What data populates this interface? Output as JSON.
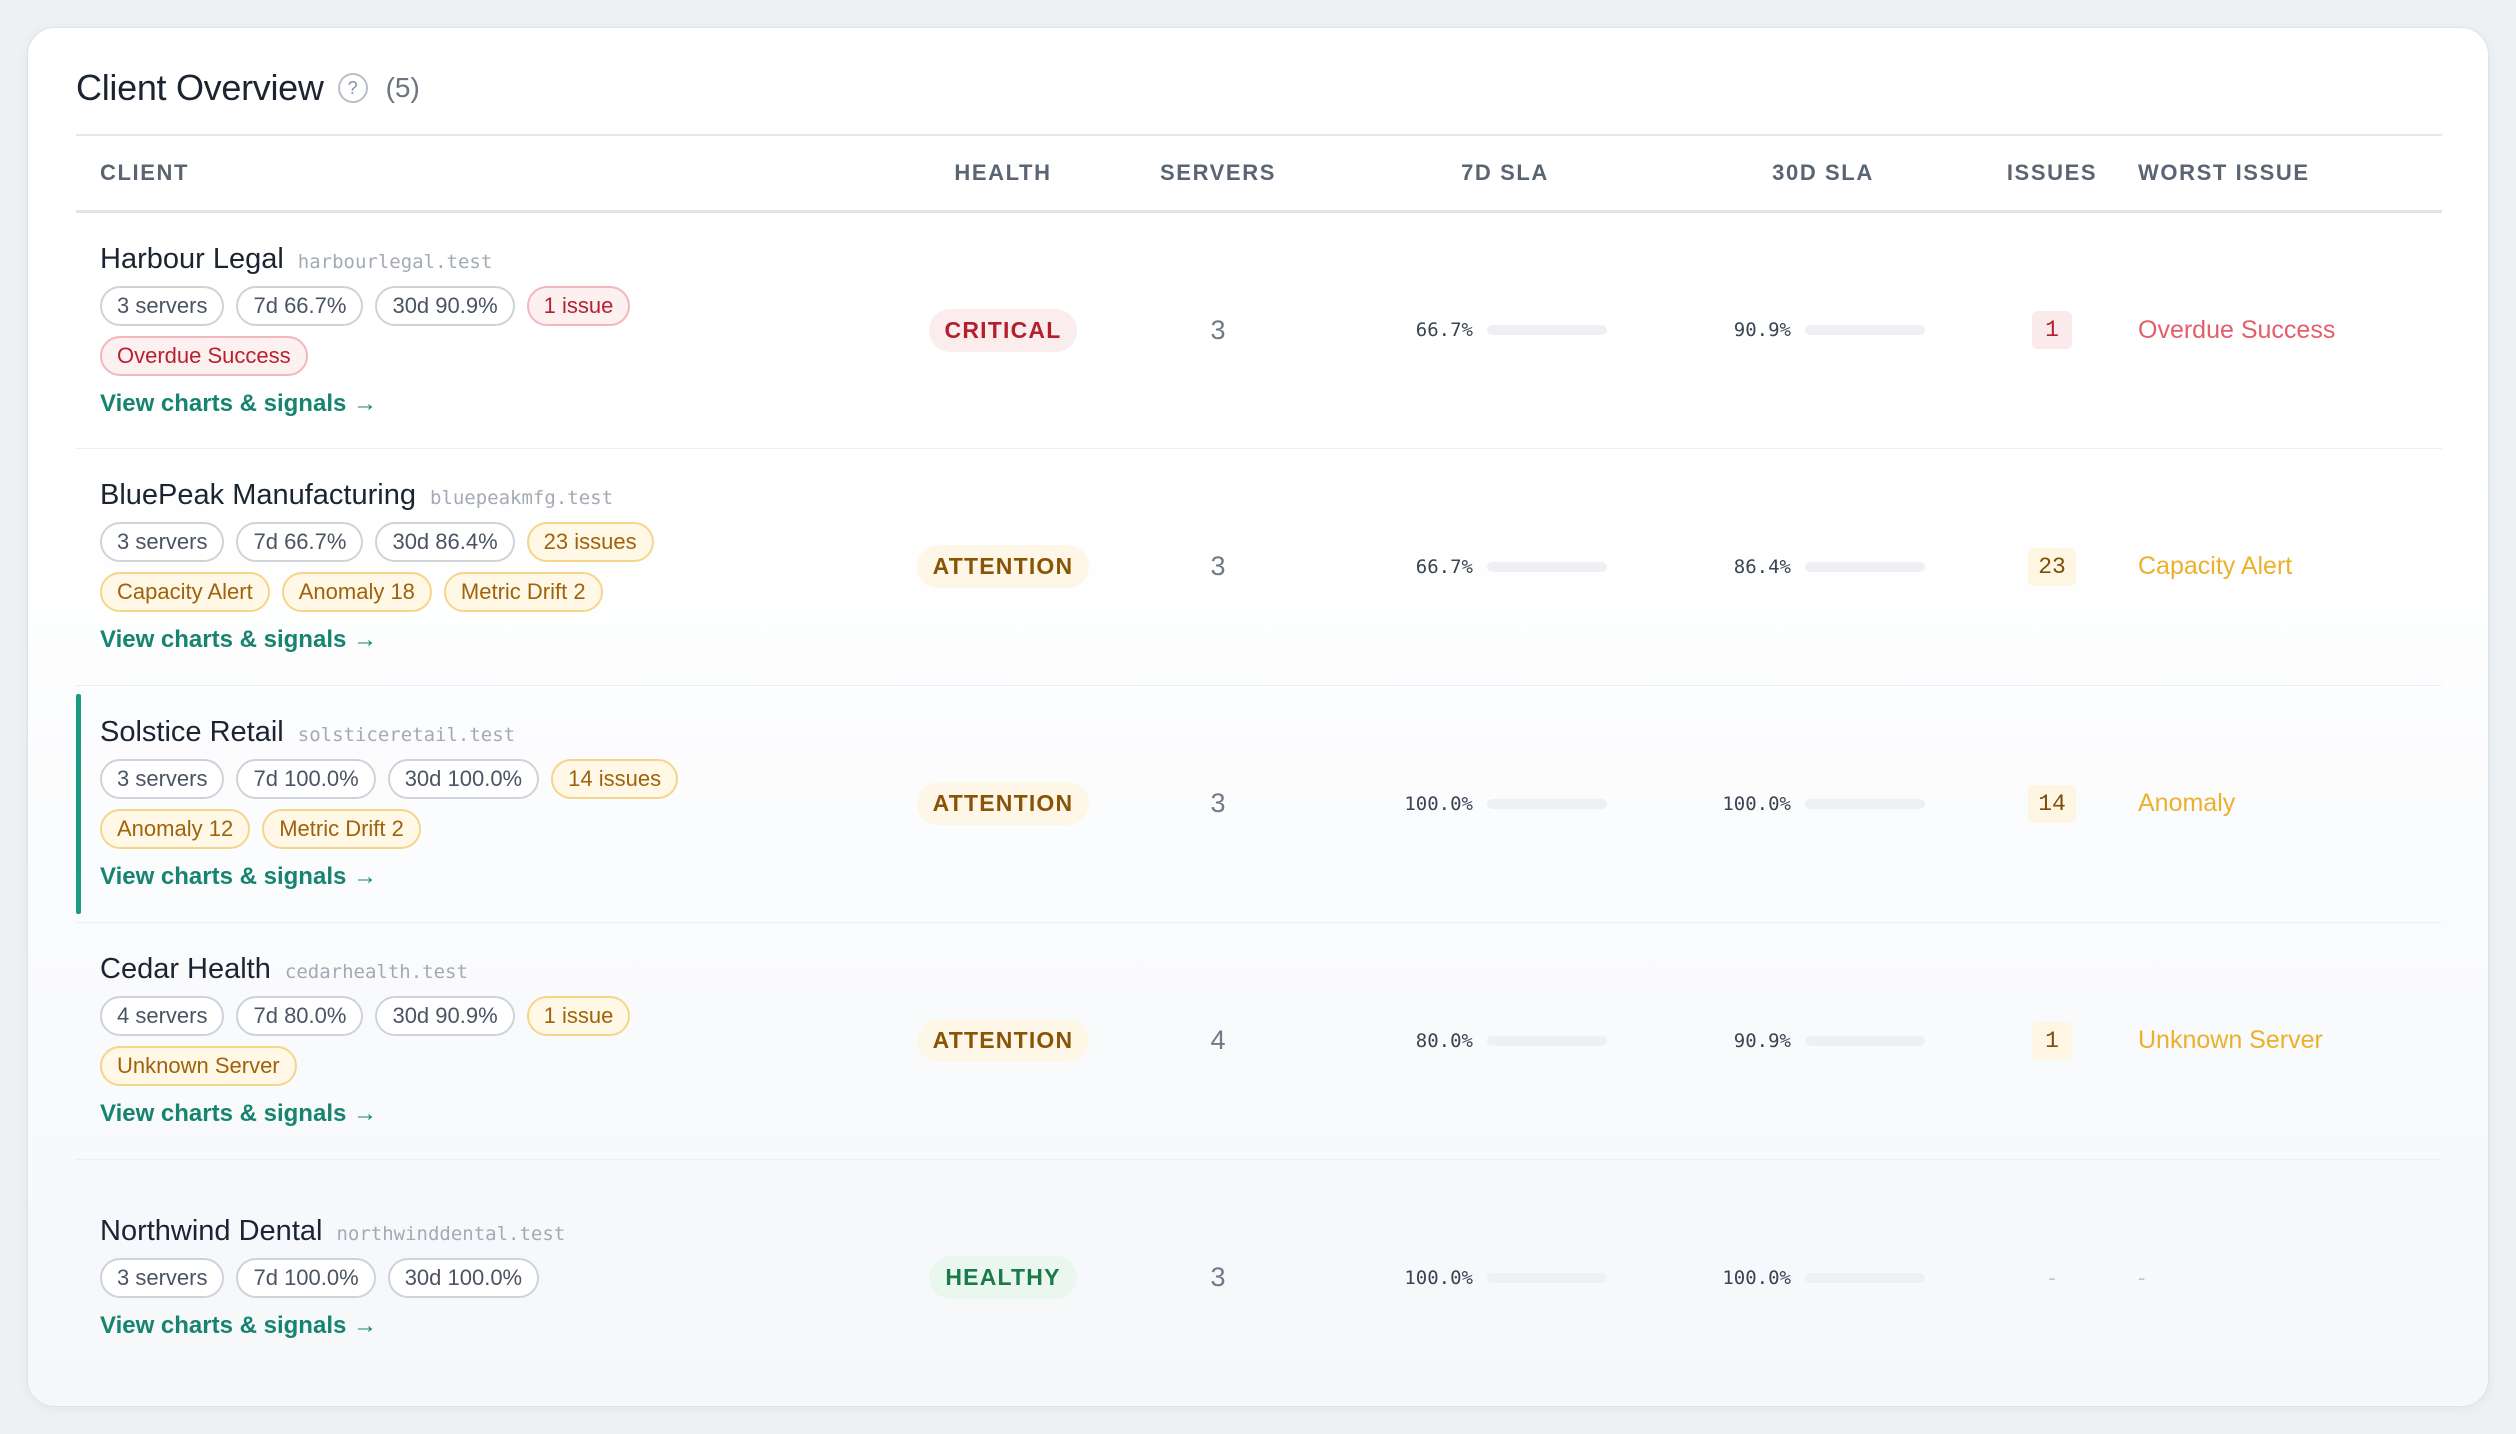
{
  "header": {
    "title": "Client Overview",
    "help": "?",
    "count": "(5)"
  },
  "columns": {
    "client": "CLIENT",
    "health": "HEALTH",
    "servers": "SERVERS",
    "sla7": "7D SLA",
    "sla30": "30D SLA",
    "issues": "ISSUES",
    "worst": "WORST ISSUE"
  },
  "link_label": "View charts & signals →",
  "rows": [
    {
      "name": "Harbour Legal",
      "domain": "harbourlegal.test",
      "chips": [
        "3 servers",
        "7d 66.7%",
        "30d 90.9%"
      ],
      "issue_chip": "1 issue",
      "tags": [
        "Overdue Success"
      ],
      "health": "CRITICAL",
      "servers": "3",
      "sla7": "66.7%",
      "sla30": "90.9%",
      "issues": "1",
      "worst": "Overdue Success"
    },
    {
      "name": "BluePeak Manufacturing",
      "domain": "bluepeakmfg.test",
      "chips": [
        "3 servers",
        "7d 66.7%",
        "30d 86.4%"
      ],
      "issue_chip": "23 issues",
      "tags": [
        "Capacity Alert",
        "Anomaly 18",
        "Metric Drift 2"
      ],
      "health": "ATTENTION",
      "servers": "3",
      "sla7": "66.7%",
      "sla30": "86.4%",
      "issues": "23",
      "worst": "Capacity Alert"
    },
    {
      "name": "Solstice Retail",
      "domain": "solsticeretail.test",
      "chips": [
        "3 servers",
        "7d 100.0%",
        "30d 100.0%"
      ],
      "issue_chip": "14 issues",
      "tags": [
        "Anomaly 12",
        "Metric Drift 2"
      ],
      "health": "ATTENTION",
      "servers": "3",
      "sla7": "100.0%",
      "sla30": "100.0%",
      "issues": "14",
      "worst": "Anomaly"
    },
    {
      "name": "Cedar Health",
      "domain": "cedarhealth.test",
      "chips": [
        "4 servers",
        "7d 80.0%",
        "30d 90.9%"
      ],
      "issue_chip": "1 issue",
      "tags": [
        "Unknown Server"
      ],
      "health": "ATTENTION",
      "servers": "4",
      "sla7": "80.0%",
      "sla30": "90.9%",
      "issues": "1",
      "worst": "Unknown Server"
    },
    {
      "name": "Northwind Dental",
      "domain": "northwinddental.test",
      "chips": [
        "3 servers",
        "7d 100.0%",
        "30d 100.0%"
      ],
      "health": "HEALTHY",
      "servers": "3",
      "sla7": "100.0%",
      "sla30": "100.0%",
      "issues": "-",
      "worst": "-"
    }
  ]
}
